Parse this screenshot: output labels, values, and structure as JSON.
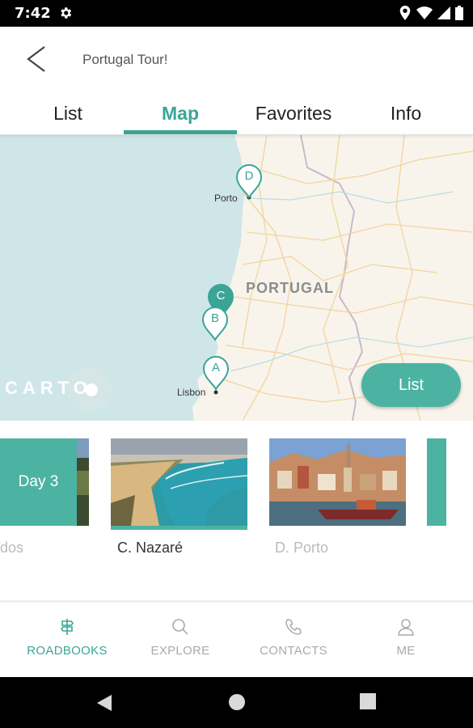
{
  "status_bar": {
    "time": "7:42"
  },
  "app_bar": {
    "title": "Portugal Tour!"
  },
  "tabs": [
    {
      "label": "List",
      "active": false
    },
    {
      "label": "Map",
      "active": true
    },
    {
      "label": "Favorites",
      "active": false
    },
    {
      "label": "Info",
      "active": false
    }
  ],
  "map": {
    "cities": {
      "porto": "Porto",
      "lisbon": "Lisbon"
    },
    "country": "PORTUGAL",
    "pins": [
      "D",
      "C",
      "B",
      "A"
    ],
    "attribution": "CARTO",
    "list_button": "List"
  },
  "cards": [
    {
      "day_label": "Day 3",
      "caption": "dos",
      "state": "faded"
    },
    {
      "caption": "C. Nazaré",
      "state": "selected"
    },
    {
      "caption": "D. Porto",
      "state": "faded"
    }
  ],
  "bottom_nav": [
    {
      "label": "ROADBOOKS",
      "icon": "signpost-icon",
      "active": true
    },
    {
      "label": "EXPLORE",
      "icon": "search-icon",
      "active": false
    },
    {
      "label": "CONTACTS",
      "icon": "phone-icon",
      "active": false
    },
    {
      "label": "ME",
      "icon": "person-icon",
      "active": false
    }
  ],
  "colors": {
    "accent": "#3aa597",
    "accent_fill": "#4cb3a2",
    "sea": "#cfe6e8",
    "land": "#f8f4ec"
  }
}
